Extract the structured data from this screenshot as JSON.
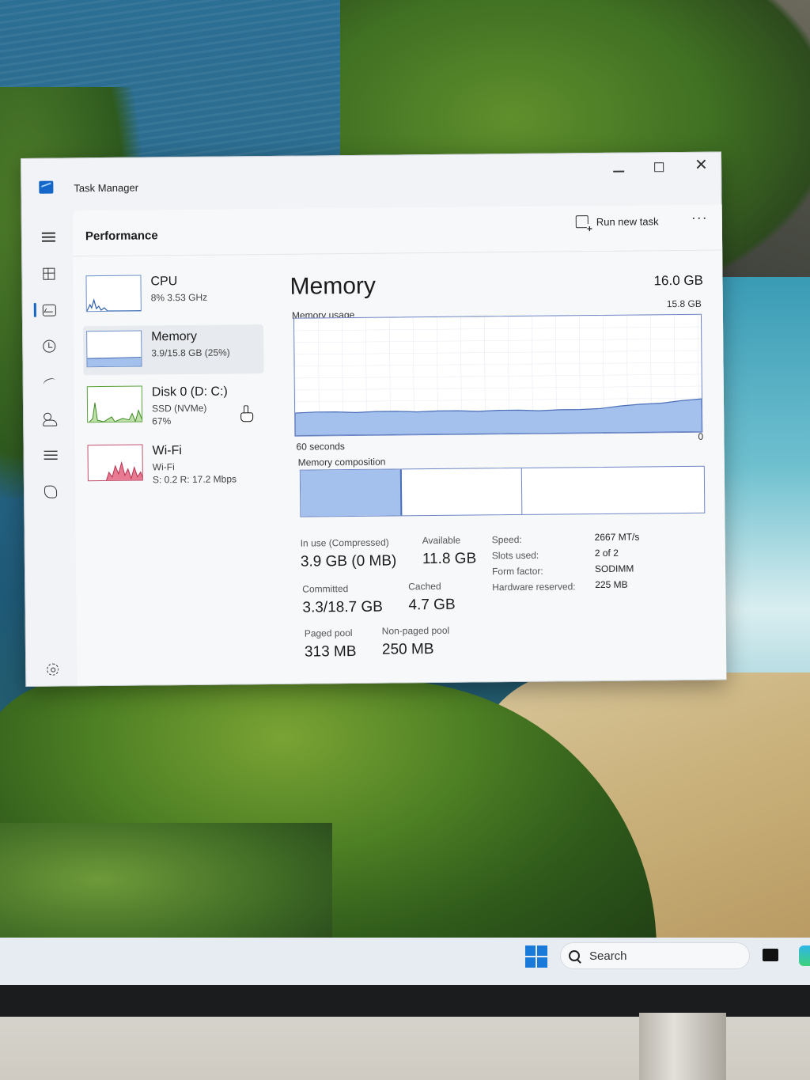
{
  "window": {
    "title": "Task Manager"
  },
  "header": {
    "page_title": "Performance",
    "run_new_task": "Run new task",
    "more": "···"
  },
  "taskbar": {
    "search_placeholder": "Search"
  },
  "sidebar": {
    "items": [
      {
        "name": "CPU",
        "line1": "8% 3.53 GHz",
        "line2": ""
      },
      {
        "name": "Memory",
        "line1": "3.9/15.8 GB (25%)",
        "line2": ""
      },
      {
        "name": "Disk 0 (D: C:)",
        "line1": "SSD (NVMe)",
        "line2": "67%"
      },
      {
        "name": "Wi-Fi",
        "line1": "Wi-Fi",
        "line2": "S: 0.2 R: 17.2 Mbps"
      }
    ]
  },
  "memory": {
    "title": "Memory",
    "total": "16.0 GB",
    "usage_label": "Memory usage",
    "usage_max": "15.8 GB",
    "axis_left": "60 seconds",
    "axis_right": "0",
    "composition_label": "Memory composition",
    "in_use_label": "In use (Compressed)",
    "in_use_value": "3.9 GB (0 MB)",
    "available_label": "Available",
    "available_value": "11.8 GB",
    "committed_label": "Committed",
    "committed_value": "3.3/18.7 GB",
    "cached_label": "Cached",
    "cached_value": "4.7 GB",
    "paged_label": "Paged pool",
    "paged_value": "313 MB",
    "nonpaged_label": "Non-paged pool",
    "nonpaged_value": "250 MB",
    "properties": {
      "speed_label": "Speed:",
      "speed_value": "2667 MT/s",
      "slots_label": "Slots used:",
      "slots_value": "2 of 2",
      "form_label": "Form factor:",
      "form_value": "SODIMM",
      "reserved_label": "Hardware reserved:",
      "reserved_value": "225 MB"
    },
    "usage_fraction": 0.25
  },
  "colors": {
    "accent": "#1466c8",
    "memory_fill": "#a4c0ec",
    "memory_line": "#4b6fb8",
    "wifi_fill": "#e87a92"
  }
}
